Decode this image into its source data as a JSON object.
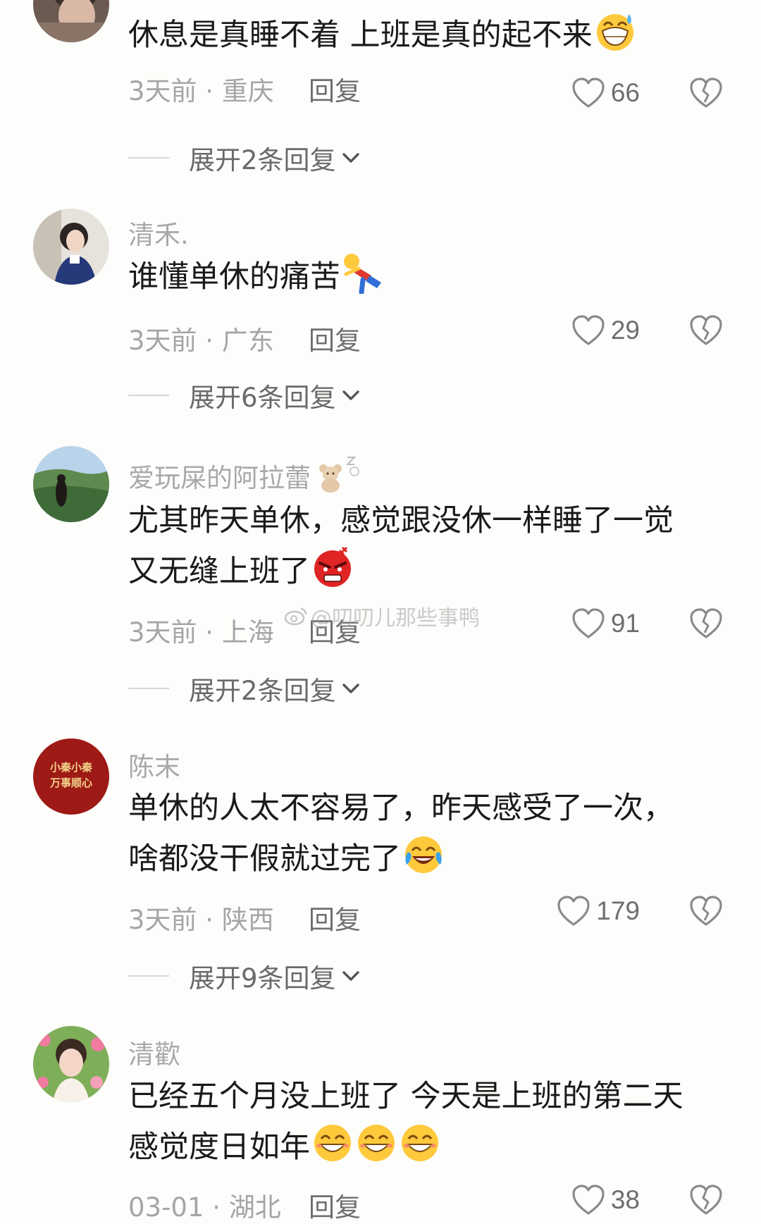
{
  "comments": [
    {
      "username": "",
      "text_lines": [
        "休息是真睡不着  上班是真的起不来"
      ],
      "emoji": "grinning-sweat-emoji",
      "time": "3天前",
      "location": "重庆",
      "reply_label": "回复",
      "likes": "66",
      "expand_label": "展开2条回复"
    },
    {
      "username": "清禾.",
      "text_lines": [
        "谁懂单休的痛苦"
      ],
      "emoji": "collapsed-person-emoji",
      "time": "3天前",
      "location": "广东",
      "reply_label": "回复",
      "likes": "29",
      "expand_label": "展开6条回复"
    },
    {
      "username": "爱玩屎的阿拉蕾",
      "text_lines": [
        "尤其昨天单休，感觉跟没休一样睡了一觉",
        "又无缝上班了"
      ],
      "emoji": "angry-face-emoji",
      "time": "3天前",
      "location": "上海",
      "reply_label": "回复",
      "likes": "91",
      "expand_label": "展开2条回复"
    },
    {
      "username": "陈末",
      "avatar_text": [
        "小秦小秦",
        "万事顺心"
      ],
      "text_lines": [
        "单休的人太不容易了，昨天感受了一次，",
        "啥都没干假就过完了"
      ],
      "emoji": "crying-laughing-emoji",
      "time": "3天前",
      "location": "陕西",
      "reply_label": "回复",
      "likes": "179",
      "expand_label": "展开9条回复"
    },
    {
      "username": "清歡",
      "text_lines": [
        "已经五个月没上班了  今天是上班的第二天",
        "感觉度日如年"
      ],
      "emoji": "smile-emoji",
      "time": "03-01",
      "location": "湖北",
      "reply_label": "回复",
      "likes": "38"
    }
  ],
  "separator": " · ",
  "watermark": "@叨叨儿那些事鸭",
  "colors": {
    "text": "#1a1a1a",
    "meta": "#a5a5a5",
    "background": "#fdfdfb"
  }
}
